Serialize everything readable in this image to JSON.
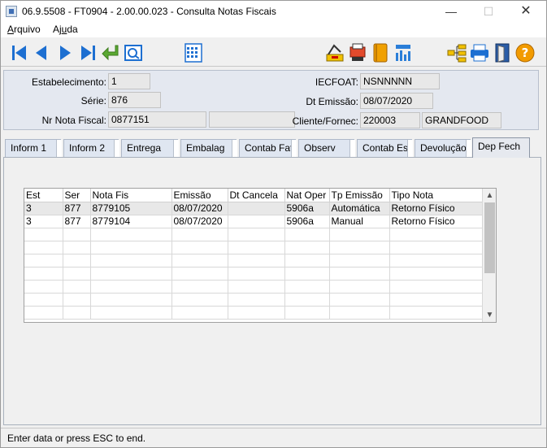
{
  "window": {
    "title": "06.9.5508 - FT0904 - 2.00.00.023 - Consulta Notas Fiscais"
  },
  "menu": [
    {
      "label_pre": "",
      "label_u": "A",
      "label_post": "rquivo"
    },
    {
      "label_pre": "Aj",
      "label_u": "u",
      "label_post": "da"
    }
  ],
  "toolbar": {
    "buttons": [
      "first-record",
      "previous-record",
      "next-record",
      "last-record",
      "go-to",
      "search",
      "calendar",
      "report",
      "print-setup",
      "notebook",
      "chart",
      "tree",
      "printer",
      "exit",
      "help"
    ]
  },
  "header": {
    "estabelecimento": {
      "label": "Estabelecimento:",
      "value": "1"
    },
    "serie": {
      "label": "Série:",
      "value": "876"
    },
    "nr_nota": {
      "label": "Nr Nota Fiscal:",
      "value": "0877151",
      "extra": ""
    },
    "iecfoat": {
      "label": "IECFOAT:",
      "value": "NSNNNNN"
    },
    "dt_emissao": {
      "label": "Dt Emissão:",
      "value": "08/07/2020"
    },
    "cliente": {
      "label": "Cliente/Fornec:",
      "code": "220003",
      "name": "GRANDFOOD"
    }
  },
  "tabs": [
    "Inform 1",
    "Inform 2",
    "Entrega",
    "Embalag",
    "Contab Fat",
    "Observ",
    "Contab Est",
    "Devolução",
    "Dep Fech"
  ],
  "active_tab": "Dep Fech",
  "grid": {
    "columns": [
      "Est",
      "Ser",
      "Nota Fis",
      "Emissão",
      "Dt Cancela",
      "Nat Oper",
      "Tp Emissão",
      "Tipo Nota"
    ],
    "rows": [
      [
        "3",
        "877",
        "8779105",
        "08/07/2020",
        "",
        "5906a",
        "Automática",
        "Retorno Físico"
      ],
      [
        "3",
        "877",
        "8779104",
        "08/07/2020",
        "",
        "5906a",
        "Manual",
        "Retorno Físico"
      ]
    ]
  },
  "status": {
    "text": "Enter data or press ESC to end."
  }
}
